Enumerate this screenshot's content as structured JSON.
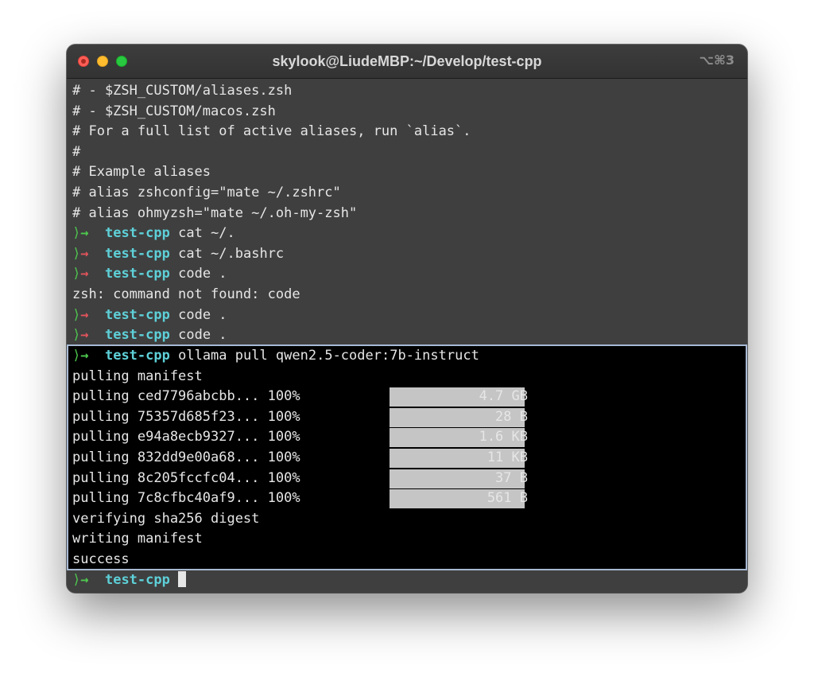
{
  "window": {
    "title": "skylook@LiudeMBP:~/Develop/test-cpp",
    "shortcut": "⌥⌘3"
  },
  "upper_pane": {
    "comment_lines": [
      "# - $ZSH_CUSTOM/aliases.zsh",
      "# - $ZSH_CUSTOM/macos.zsh",
      "# For a full list of active aliases, run `alias`.",
      "#",
      "# Example aliases",
      "# alias zshconfig=\"mate ~/.zshrc\"",
      "# alias ohmyzsh=\"mate ~/.oh-my-zsh\""
    ],
    "prompts": [
      {
        "dir": "test-cpp",
        "command": "cat ~/."
      },
      {
        "dir": "test-cpp",
        "command": "cat ~/.bashrc"
      },
      {
        "dir": "test-cpp",
        "command": "code ."
      },
      {
        "dir": "test-cpp",
        "command": "code ."
      },
      {
        "dir": "test-cpp",
        "command": "code ."
      }
    ],
    "error_line": "zsh: command not found: code"
  },
  "lower_pane": {
    "prompt": {
      "dir": "test-cpp",
      "command": "ollama pull qwen2.5-coder:7b-instruct"
    },
    "manifest_line": "pulling manifest",
    "layers": [
      {
        "label": "pulling ced7796abcbb... 100%",
        "size": "4.7 GB",
        "progress": 1.0
      },
      {
        "label": "pulling 75357d685f23... 100%",
        "size": "28 B",
        "progress": 1.0
      },
      {
        "label": "pulling e94a8ecb9327... 100%",
        "size": "1.6 KB",
        "progress": 1.0
      },
      {
        "label": "pulling 832dd9e00a68... 100%",
        "size": "11 KB",
        "progress": 1.0
      },
      {
        "label": "pulling 8c205fccfc04... 100%",
        "size": "37 B",
        "progress": 1.0
      },
      {
        "label": "pulling 7c8cfbc40af9... 100%",
        "size": "561 B",
        "progress": 1.0
      }
    ],
    "tail_lines": [
      "verifying sha256 digest",
      "writing manifest",
      "success"
    ]
  },
  "bottom_prompt": {
    "dir": "test-cpp"
  },
  "colors": {
    "prompt_arrow": "#4ec94e",
    "prompt_arrow_error": "#e2545c",
    "directory": "#5ed0d8",
    "active_pane_border": "#a7b9d3"
  }
}
